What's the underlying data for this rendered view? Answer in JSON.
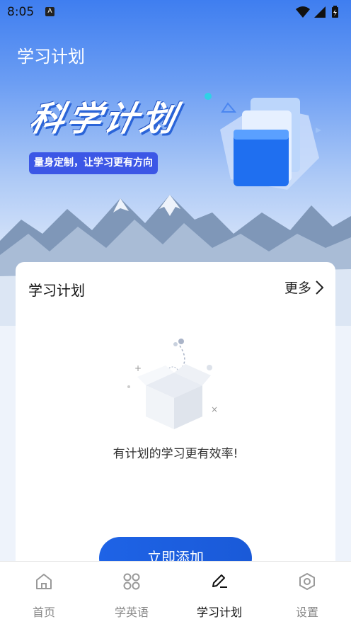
{
  "status_bar": {
    "time": "8:05",
    "notification_badge": "A",
    "icons": [
      "wifi-icon",
      "signal-icon",
      "battery-icon"
    ]
  },
  "header": {
    "title": "学习计划"
  },
  "banner": {
    "title": "科学计划",
    "subtitle": "量身定制，让学习更有方向"
  },
  "card": {
    "title": "学习计划",
    "more_label": "更多",
    "empty_text": "有计划的学习更有效率!",
    "add_button_label": "立即添加"
  },
  "bottom_nav": {
    "items": [
      {
        "label": "首页",
        "icon": "home-icon",
        "active": false
      },
      {
        "label": "学英语",
        "icon": "grid-icon",
        "active": false
      },
      {
        "label": "学习计划",
        "icon": "edit-plan-icon",
        "active": true
      },
      {
        "label": "设置",
        "icon": "settings-icon",
        "active": false
      }
    ]
  },
  "colors": {
    "primary": "#1e63e6",
    "badge": "#3c57e6",
    "active_nav": "#111111",
    "inactive_nav": "#888888"
  }
}
